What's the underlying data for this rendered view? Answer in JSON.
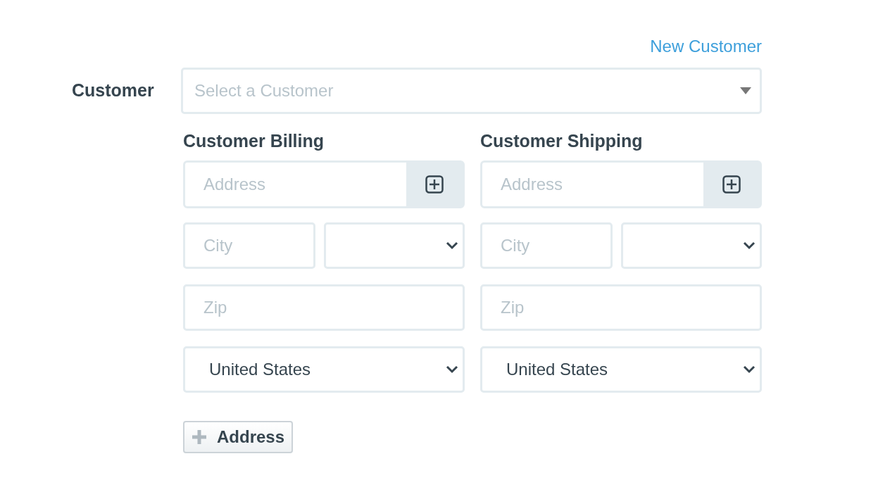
{
  "new_customer_link": "New Customer",
  "customer": {
    "label": "Customer",
    "placeholder": "Select a Customer"
  },
  "sections": [
    {
      "heading": "Customer Billing",
      "address": {
        "placeholder": "Address"
      },
      "city": {
        "placeholder": "City"
      },
      "zip": {
        "placeholder": "Zip"
      },
      "country": "United States"
    },
    {
      "heading": "Customer Shipping",
      "address": {
        "placeholder": "Address"
      },
      "city": {
        "placeholder": "City"
      },
      "zip": {
        "placeholder": "Zip"
      },
      "country": "United States"
    }
  ],
  "add_button": "Address"
}
